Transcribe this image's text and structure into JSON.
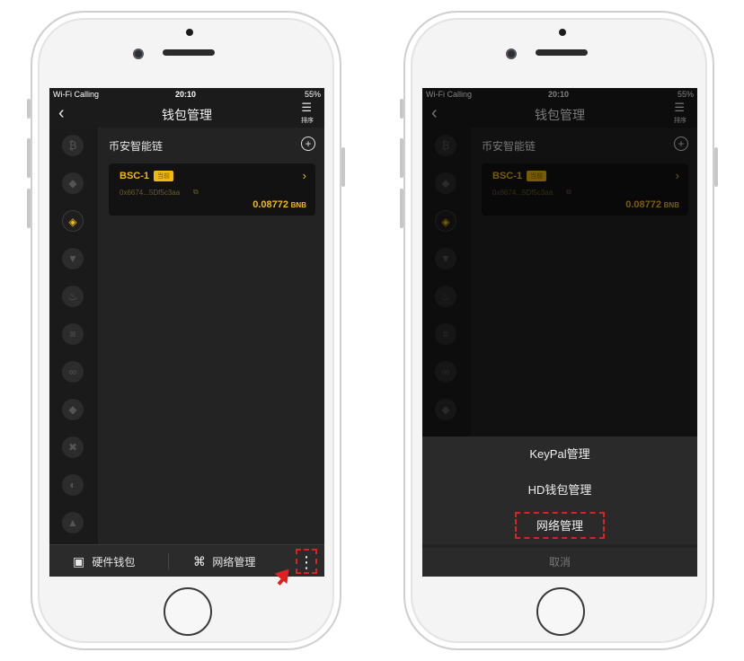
{
  "status": {
    "carrier": "Wi-Fi Calling",
    "time": "20:10",
    "battery": "55%"
  },
  "nav": {
    "back_icon": "chevron-left-icon",
    "title": "钱包管理",
    "sort_label": "排序"
  },
  "section": {
    "title": "币安智能链"
  },
  "wallet_card": {
    "name": "BSC-1",
    "badge": "当前",
    "address": "0x6674...5Df5c3aa",
    "amount": "0.08772",
    "unit": "BNB"
  },
  "chains": [
    "bitcoin-icon",
    "ethereum-icon",
    "bnb-icon",
    "tron-icon",
    "heco-icon",
    "solana-icon",
    "polygon-icon",
    "ethereum-classic-icon",
    "okex-icon",
    "fantom-icon",
    "avalanche-icon"
  ],
  "bottom": {
    "hardware_label": "硬件钱包",
    "network_label": "网络管理"
  },
  "sheet": {
    "item1": "KeyPal管理",
    "item2": "HD钱包管理",
    "item3": "网络管理",
    "cancel": "取消"
  },
  "colors": {
    "accent": "#f0b90b",
    "highlight": "#e02020",
    "screen_bg": "#232323"
  }
}
